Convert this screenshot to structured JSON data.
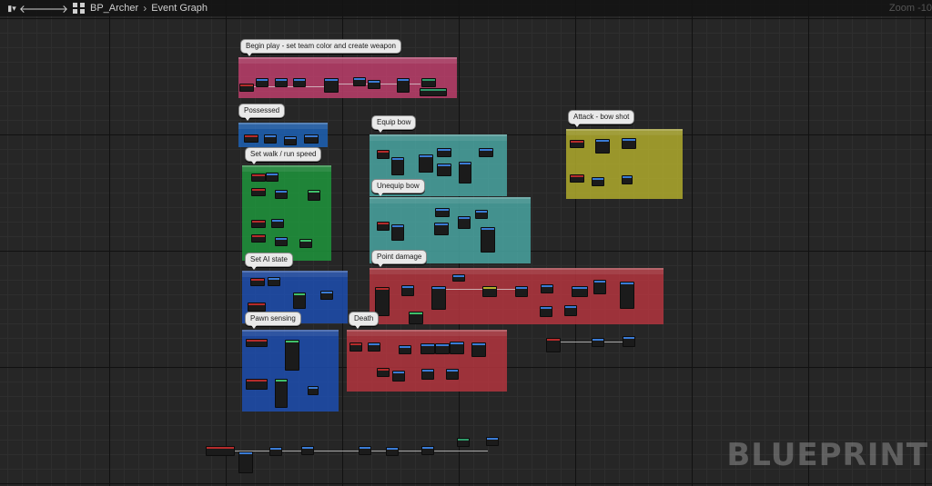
{
  "toolbar": {
    "menu_icon": "blueprint-menu-icon",
    "back_icon": "arrow-left-icon",
    "forward_icon": "arrow-right-icon",
    "blueprint_icon": "blueprint-class-icon",
    "breadcrumb": [
      "BP_Archer",
      "Event Graph"
    ],
    "zoom_label": "Zoom -10"
  },
  "comments": [
    {
      "label": "Begin play - set team color and create weapon",
      "color": "#c2406e"
    },
    {
      "label": "Possessed",
      "color": "#1d62b5"
    },
    {
      "label": "Set walk / run speed",
      "color": "#1f9a3d"
    },
    {
      "label": "Equip bow",
      "color": "#4aa9a6"
    },
    {
      "label": "Unequip bow",
      "color": "#4aa9a6"
    },
    {
      "label": "Attack - bow shot",
      "color": "#b5b02d"
    },
    {
      "label": "Set AI state",
      "color": "#1d4fb5"
    },
    {
      "label": "Point damage",
      "color": "#b8363f"
    },
    {
      "label": "Pawn sensing",
      "color": "#1d4fb5"
    },
    {
      "label": "Death",
      "color": "#b8363f"
    }
  ],
  "watermark": "BLUEPRINT"
}
